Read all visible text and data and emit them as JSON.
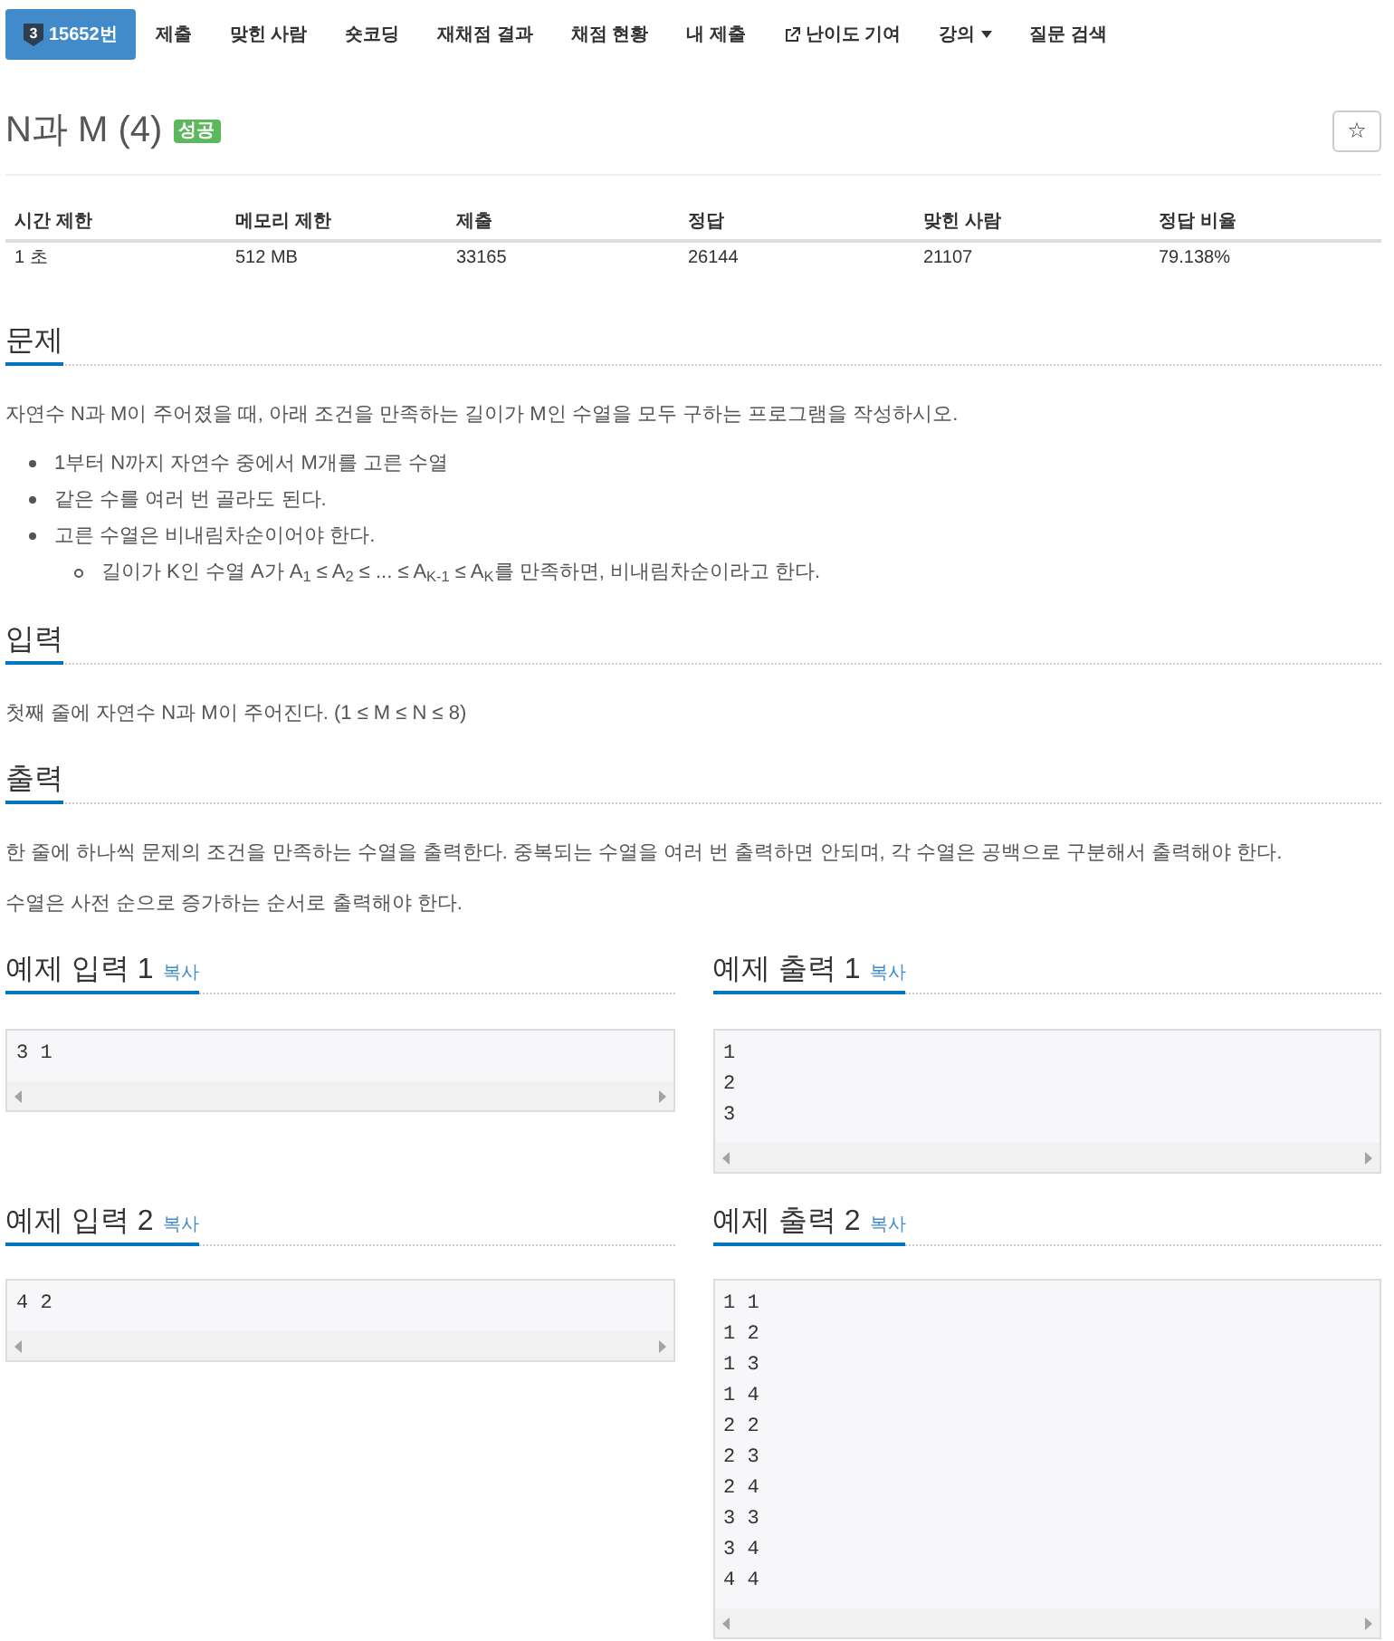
{
  "nav": {
    "items": [
      {
        "kind": "problem",
        "tier": "3",
        "label": "15652번",
        "selected": true
      },
      {
        "kind": "link",
        "label": "제출",
        "selected": false
      },
      {
        "kind": "link",
        "label": "맞힌 사람",
        "selected": false
      },
      {
        "kind": "link",
        "label": "숏코딩",
        "selected": false
      },
      {
        "kind": "link",
        "label": "재채점 결과",
        "selected": false
      },
      {
        "kind": "link",
        "label": "채점 현황",
        "selected": false
      },
      {
        "kind": "link",
        "label": "내 제출",
        "selected": false
      },
      {
        "kind": "external",
        "label": "난이도 기여",
        "selected": false
      },
      {
        "kind": "dropdown",
        "label": "강의",
        "selected": false
      },
      {
        "kind": "link",
        "label": "질문 검색",
        "selected": false
      }
    ]
  },
  "problem": {
    "title": "N과 M (4)",
    "badge": "성공",
    "star": "☆"
  },
  "limits_table": {
    "columns": [
      "시간 제한",
      "메모리 제한",
      "제출",
      "정답",
      "맞힌 사람",
      "정답 비율"
    ],
    "rows": [
      [
        "1 초",
        "512 MB",
        "33165",
        "26144",
        "21107",
        "79.138%"
      ]
    ]
  },
  "sections": [
    {
      "heading": "문제",
      "blocks": [
        {
          "kind": "paragraph",
          "text": "자연수 N과 M이 주어졌을 때, 아래 조건을 만족하는 길이가 M인 수열을 모두 구하는 프로그램을 작성하시오."
        },
        {
          "kind": "list",
          "items": [
            {
              "text": "1부터 N까지 자연수 중에서 M개를 고른 수열"
            },
            {
              "text": "같은 수를 여러 번 골라도 된다."
            },
            {
              "text": "고른 수열은 비내림차순이어야 한다.",
              "children": [
                {
                  "text": "길이가 K인 수열 A가 A$_{1}$ ≤ A$_{2}$ ≤ ... ≤ A$_{K-1}$ ≤ A$_{K}$를 만족하면, 비내림차순이라고 한다."
                }
              ]
            }
          ]
        }
      ]
    },
    {
      "heading": "입력",
      "blocks": [
        {
          "kind": "paragraph",
          "text": "첫째 줄에 자연수 N과 M이 주어진다. (1 ≤ M ≤ N ≤ 8)"
        }
      ]
    },
    {
      "heading": "출력",
      "blocks": [
        {
          "kind": "paragraph",
          "text": "한 줄에 하나씩 문제의 조건을 만족하는 수열을 출력한다. 중복되는 수열을 여러 번 출력하면 안되며, 각 수열은 공백으로 구분해서 출력해야 한다."
        },
        {
          "kind": "paragraph",
          "text": "수열은 사전 순으로 증가하는 순서로 출력해야 한다."
        }
      ]
    }
  ],
  "examples": [
    {
      "input": {
        "heading": "예제 입력 1",
        "copy": "복사",
        "lines": [
          "3 1"
        ]
      },
      "output": {
        "heading": "예제 출력 1",
        "copy": "복사",
        "lines": [
          "1",
          "2",
          "3"
        ]
      }
    },
    {
      "input": {
        "heading": "예제 입력 2",
        "copy": "복사",
        "lines": [
          "4 2"
        ]
      },
      "output": {
        "heading": "예제 출력 2",
        "copy": "복사",
        "lines": [
          "1 1",
          "1 2",
          "1 3",
          "1 4",
          "2 2",
          "2 3",
          "2 4",
          "3 3",
          "3 4",
          "4 4"
        ]
      }
    }
  ]
}
